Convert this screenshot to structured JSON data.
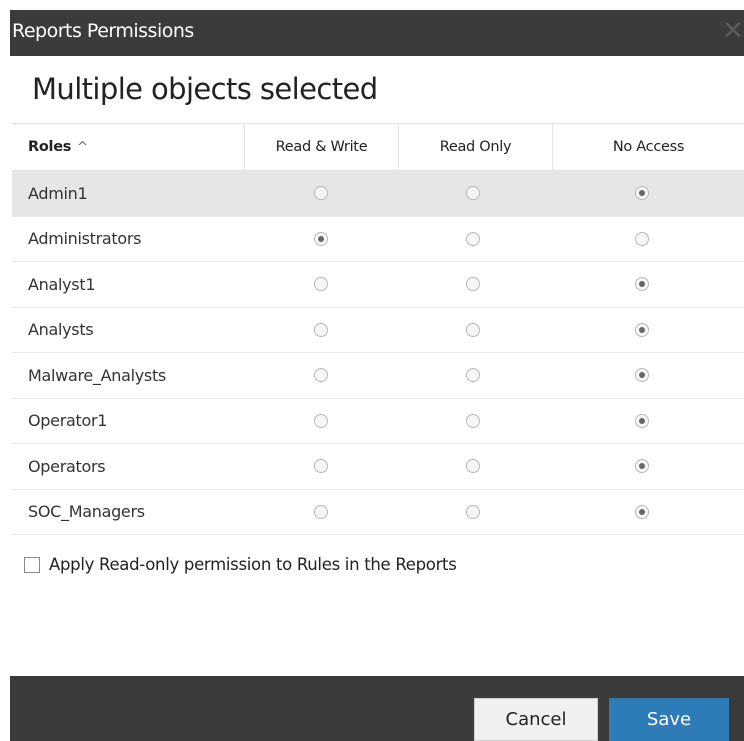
{
  "dialog": {
    "title": "Reports Permissions",
    "close_glyph": "✕",
    "heading": "Multiple objects selected"
  },
  "table": {
    "headers": {
      "role": "Roles",
      "sort_glyph": "^",
      "read_write": "Read & Write",
      "read_only": "Read Only",
      "no_access": "No Access"
    },
    "rows": [
      {
        "role": "Admin1",
        "permission": "no_access",
        "selected": true
      },
      {
        "role": "Administrators",
        "permission": "read_write",
        "selected": false
      },
      {
        "role": "Analyst1",
        "permission": "no_access",
        "selected": false
      },
      {
        "role": "Analysts",
        "permission": "no_access",
        "selected": false
      },
      {
        "role": "Malware_Analysts",
        "permission": "no_access",
        "selected": false
      },
      {
        "role": "Operator1",
        "permission": "no_access",
        "selected": false
      },
      {
        "role": "Operators",
        "permission": "no_access",
        "selected": false
      },
      {
        "role": "SOC_Managers",
        "permission": "no_access",
        "selected": false
      }
    ]
  },
  "apply_option": {
    "label": "Apply Read-only permission to Rules in the Reports",
    "checked": false
  },
  "footer": {
    "cancel_label": "Cancel",
    "save_label": "Save"
  },
  "colors": {
    "titlebar": "#3b3b3b",
    "save_button": "#2d7bb7",
    "selected_row": "#e6e6e6"
  }
}
